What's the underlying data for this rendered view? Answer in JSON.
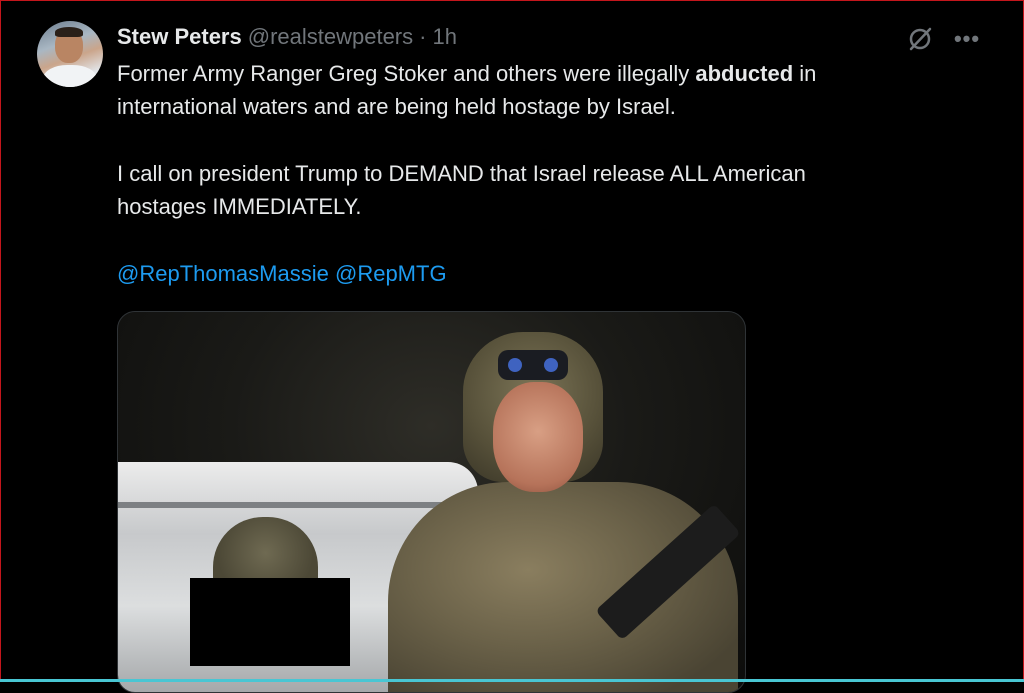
{
  "tweet": {
    "author_name": "Stew Peters",
    "handle": "@realstewpeters",
    "separator": "·",
    "time": "1h",
    "line1_pre": "Former Army Ranger Greg Stoker and others were illegally ",
    "line1_bold": "abducted",
    "line1_post": " in",
    "line2": "international waters and are being held hostage by Israel.",
    "line3": "I call on president Trump to DEMAND that Israel release ALL American",
    "line4": "hostages IMMEDIATELY.",
    "mention1": "@RepThomasMassie",
    "mention2": "@RepMTG"
  },
  "icons": {
    "grok": "grok-icon",
    "more": "more-icon",
    "more_glyph": "•••"
  },
  "colors": {
    "background": "#000000",
    "text": "#e7e9ea",
    "secondary": "#71767b",
    "link": "#1d9bf0"
  }
}
